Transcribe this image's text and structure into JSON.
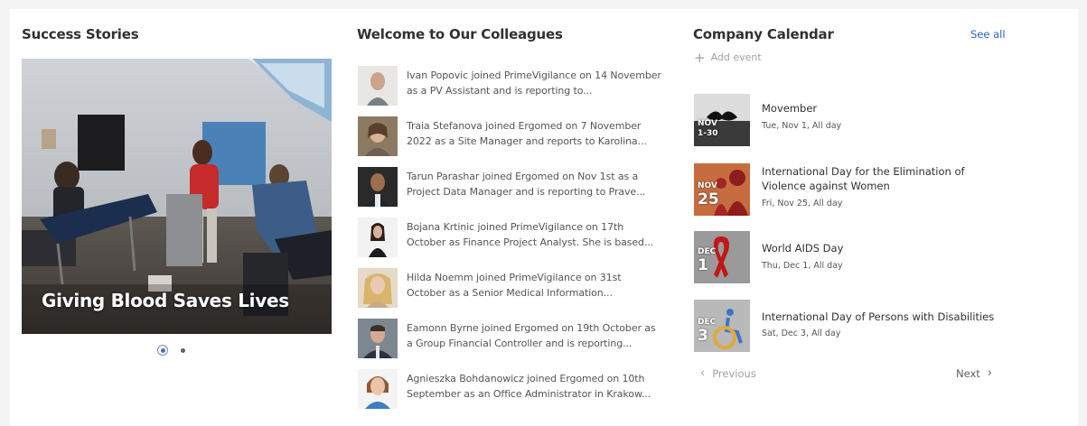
{
  "success_stories": {
    "title": "Success Stories",
    "slide_caption": "Giving Blood Saves Lives",
    "slide_count": 2,
    "active_slide": 1
  },
  "colleagues": {
    "title": "Welcome to Our Colleagues",
    "items": [
      {
        "text": "Ivan Popovic joined PrimeVigilance on 14 November as a PV Assistant and is reporting to..."
      },
      {
        "text": "Traia Stefanova joined Ergomed on 7 November 2022 as a Site Manager and reports to Karolina..."
      },
      {
        "text": "Tarun Parashar joined Ergomed on Nov 1st as a Project Data Manager and is reporting to Prave..."
      },
      {
        "text": "Bojana Krtinic joined PrimeVigilance on 17th October as Finance Project Analyst. She is based..."
      },
      {
        "text": "Hilda Noemm joined PrimeVigilance on 31st October as a Senior Medical Information..."
      },
      {
        "text": "Eamonn Byrne joined Ergomed on 19th October as a Group Financial Controller and is reporting..."
      },
      {
        "text": "Agnieszka Bohdanowicz joined Ergomed on 10th September as an Office Administrator in Krakow..."
      }
    ]
  },
  "calendar": {
    "title": "Company Calendar",
    "see_all": "See all",
    "add_event": "Add event",
    "events": [
      {
        "thumb_month": "NOV",
        "thumb_day": "1-30",
        "title": "Movember",
        "when": "Tue, Nov 1, All day"
      },
      {
        "thumb_month": "NOV",
        "thumb_day": "25",
        "title": "International Day for the Elimination of Violence against Women",
        "when": "Fri, Nov 25, All day"
      },
      {
        "thumb_month": "DEC",
        "thumb_day": "1",
        "title": "World AIDS Day",
        "when": "Thu, Dec 1, All day"
      },
      {
        "thumb_month": "DEC",
        "thumb_day": "3",
        "title": "International Day of Persons with Disabilities",
        "when": "Sat, Dec 3, All day"
      }
    ],
    "previous": "Previous",
    "next": "Next"
  }
}
